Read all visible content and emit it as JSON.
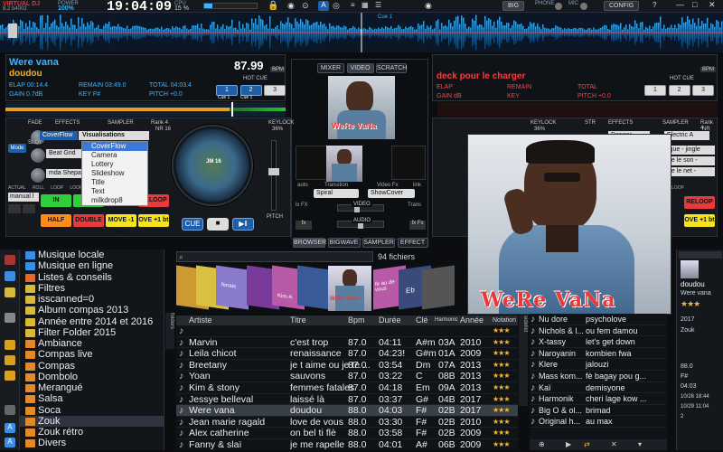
{
  "topbar": {
    "logo": "VIRTUAL DJ",
    "version": "8.2 b4002",
    "power_label": "POWER",
    "power_value": "100%",
    "clock": "19:04:09",
    "cpu_label": "CPU",
    "cpu_value": "15 %",
    "big_label": "BIG",
    "phone_label": "PHONE",
    "mic_label": "MIC",
    "config_label": "CONFIG",
    "cue_marker": "Cue 1",
    "left_cue_marker": "Cue 1"
  },
  "deck_left": {
    "title": "Were vana",
    "artist": "doudou",
    "bpm": "87.99",
    "bpm_label": "BPM",
    "elapsed": "ELAP 00:14.4",
    "remain": "REMAIN 03:49.0",
    "total": "TOTAL 04:03.4",
    "gain": "GAIN 0.7dB",
    "key": "KEY F#",
    "pitch": "PITCH +0.0",
    "hotcue_label": "HOT CUE",
    "hotcues": [
      "1",
      "2",
      "3"
    ],
    "hotcue_subs": [
      "Cue 1",
      "Cue 1",
      ""
    ],
    "fade_label": "FADE",
    "effects_label": "EFFECTS",
    "sampler_label": "SAMPLER",
    "bank_label": "Rank 4",
    "bank_nr": "NR 16",
    "mode_label": "Mode",
    "slot_label": "SLOT",
    "beatgrid": "Beat Grid",
    "sample_name": "mda Shepard",
    "keylock_label": "KEYLOCK",
    "keylock_value": "36%",
    "jog_label": "JM 16",
    "pitch_label": "PITCH",
    "manual_value": "manual l",
    "loop_labels": [
      "ACTUAL",
      "ROLL",
      "LOOP",
      "LOOP"
    ],
    "pads": [
      "IN",
      "OUT",
      "RELOOP",
      "HALF",
      "DOUBLE",
      "MOVE -1 bt",
      "OVE +1 bt"
    ],
    "cue_btn": "CUE",
    "stop_btn": "■",
    "play_btn": "▶‖"
  },
  "deck_right": {
    "title": "deck pour le charger",
    "elapsed": "ELAP",
    "remain": "REMAIN",
    "total": "TOTAL",
    "gain": "GAIN dB",
    "key": "KEY",
    "pitch": "PITCH +0.0",
    "bpm_label": "BPM",
    "hotcue_label": "HOT CUE",
    "hotcues": [
      "1",
      "2",
      "3"
    ],
    "keylock_label": "KEYLOCK",
    "keylock_value": "36%",
    "str_label": "STR",
    "effects_label": "EFFECTS",
    "sampler_label": "SAMPLER",
    "bank_label": "Rank 4",
    "bank_nr": "NR 16",
    "effect_name": "Danger",
    "sample_name": "Electric A",
    "list_items": [
      "ique - jingle",
      "ue le son -",
      "ue le net -"
    ],
    "loop_label": "LOOP",
    "pads": [
      "RELOOP",
      "OVE +1 bt"
    ]
  },
  "mixer": {
    "tabs": [
      "MIXER",
      "VIDEO",
      "SCRATCH"
    ],
    "bottom_tabs": [
      "BROWSER",
      "BIGWAVE",
      "SAMPLER",
      "EFFECT"
    ],
    "auto_label": "auto",
    "transition_label": "Transition",
    "transition_value": "Spiral",
    "videofx_label": "Video Fx",
    "videofx_value": "ShowCover",
    "link_label": "link",
    "video_label": "VIDEO",
    "audio_label": "AUDIO",
    "trans_label": "Trans",
    "fx_label": "fx",
    "lfx_label": "lx FX",
    "rfx_label": "fx Fx"
  },
  "video_overlay": {
    "text": "WeRe VaNa",
    "small_text": "WeRe VaNa"
  },
  "vis_menu": {
    "header": "Visualisations",
    "items": [
      "CoverFlow",
      "Camera",
      "Lottery",
      "Slideshow",
      "Title",
      "Text",
      "milkdrop8"
    ],
    "selected_index": 0,
    "field_value": "CoverFlow"
  },
  "browser": {
    "search_placeholder": "",
    "file_count": "94 fichiers",
    "cover_texts": [
      "fenais",
      "Kim-A",
      "fe au de vous",
      "Eb"
    ],
    "tree": [
      "Musique locale",
      "Musique en ligne",
      "Listes & conseils",
      "Filtres",
      "isscanned=0",
      "Album compas 2013",
      "Année entre 2014 et 2016",
      "Filter Folder 2015",
      "Ambiance",
      "Compas live",
      "Compas",
      "Dombolo",
      "Merangué",
      "Salsa",
      "Soca",
      "Zouk",
      "Zouk rétro",
      "Divers"
    ],
    "tree_selected": 15,
    "tree_colors": [
      "#3a8ee6",
      "#3a8ee6",
      "#e06a2a",
      "#d9b93a",
      "#d9b93a",
      "#d9b93a",
      "#d9b93a",
      "#d9b93a",
      "#e08a2a",
      "#e08a2a",
      "#e08a2a",
      "#e08a2a",
      "#e08a2a",
      "#e08a2a",
      "#e08a2a",
      "#e08a2a",
      "#e08a2a",
      "#e08a2a"
    ],
    "side_tab": "folders",
    "side_tab_right": "sidelist",
    "columns": [
      "Artiste",
      "Titre",
      "Bpm",
      "Durée",
      "Clé",
      "Harmonic",
      "Année",
      "Notation"
    ],
    "rows": [
      {
        "artist": "",
        "title": "",
        "bpm": "",
        "dur": "",
        "key": "",
        "harm": "",
        "year": "",
        "stars": "★★★"
      },
      {
        "artist": "Marvin",
        "title": "c'est trop",
        "bpm": "87.0",
        "dur": "04:11",
        "key": "A#m",
        "harm": "03A",
        "year": "2010",
        "stars": "★★★"
      },
      {
        "artist": "Leila chicot",
        "title": "renaissance",
        "bpm": "87.0",
        "dur": "04:23!",
        "key": "G#m",
        "harm": "01A",
        "year": "2009",
        "stars": "★★★"
      },
      {
        "artist": "Breetany",
        "title": "je t aime ou je te ...",
        "bpm": "87.0",
        "dur": "03:54",
        "key": "Dm",
        "harm": "07A",
        "year": "2013",
        "stars": "★★★"
      },
      {
        "artist": "Yoan",
        "title": "sauvons",
        "bpm": "87.0",
        "dur": "03:22",
        "key": "C",
        "harm": "08B",
        "year": "2013",
        "stars": "★★★"
      },
      {
        "artist": "Kim & stony",
        "title": "femmes fatales",
        "bpm": "87.0",
        "dur": "04:18",
        "key": "Em",
        "harm": "09A",
        "year": "2013",
        "stars": "★★★"
      },
      {
        "artist": "Jessye belleval",
        "title": "laissé là",
        "bpm": "87.0",
        "dur": "03:37",
        "key": "G#",
        "harm": "04B",
        "year": "2017",
        "stars": "★★★"
      },
      {
        "artist": "Were vana",
        "title": "doudou",
        "bpm": "88.0",
        "dur": "04:03",
        "key": "F#",
        "harm": "02B",
        "year": "2017",
        "stars": "★★★"
      },
      {
        "artist": "Jean marie ragald",
        "title": "love de vous",
        "bpm": "88.0",
        "dur": "03:30",
        "key": "F#",
        "harm": "02B",
        "year": "2010",
        "stars": "★★★"
      },
      {
        "artist": "Alex catherine",
        "title": "on bel ti flè",
        "bpm": "88.0",
        "dur": "03:58",
        "key": "F#",
        "harm": "02B",
        "year": "2009",
        "stars": "★★★"
      },
      {
        "artist": "Fanny & slaï",
        "title": "je me rapelle",
        "bpm": "88.0",
        "dur": "04:01",
        "key": "A#",
        "harm": "06B",
        "year": "2009",
        "stars": "★★★"
      }
    ],
    "selected_row": 7,
    "right_list": [
      {
        "a": "Nu dore",
        "b": "psycholove"
      },
      {
        "a": "Nichols & l...",
        "b": "ou fem damou"
      },
      {
        "a": "X-tassy",
        "b": "let's get down"
      },
      {
        "a": "Naroyanin",
        "b": "kombien fwa"
      },
      {
        "a": "Klere",
        "b": "jalouzi"
      },
      {
        "a": "Mass kom...",
        "b": "fè bagay pou g..."
      },
      {
        "a": "Kaï",
        "b": "demisyone"
      },
      {
        "a": "Harmonik",
        "b": "cheri lage kow ..."
      },
      {
        "a": "Big O & ol...",
        "b": "brimad"
      },
      {
        "a": "Original h...",
        "b": "au max"
      }
    ]
  },
  "info_panel": {
    "title": "doudou",
    "artist": "Were vana",
    "stars": "★★★",
    "year": "2017",
    "genre": "Zouk",
    "bpm": "88.0",
    "key": "F#",
    "duration": "04:03",
    "date1": "10/26 18:44",
    "date2": "10/29 11:04",
    "count": "2"
  },
  "colors": {
    "accent_blue": "#3bb6ff",
    "accent_red": "#ff3a3a",
    "pad_green": "#2fcf3a",
    "pad_red": "#e83a3a",
    "pad_orange": "#ff8a1a",
    "pad_yellow": "#f5e51a"
  }
}
